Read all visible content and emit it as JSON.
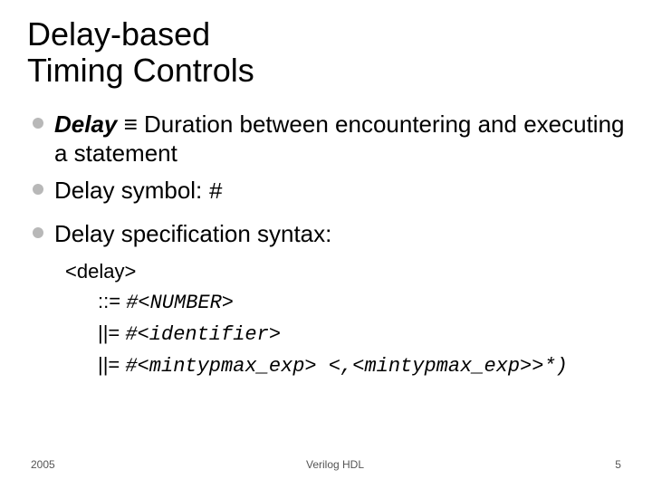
{
  "title_line1": "Delay-based",
  "title_line2": "Timing Controls",
  "bullets": [
    {
      "lead": "Delay",
      "sep": " ≡ ",
      "rest": "Duration between encountering and executing a statement"
    },
    {
      "text": "Delay symbol: ",
      "code": "#"
    },
    {
      "text": "Delay specification syntax:"
    }
  ],
  "syntax": {
    "lhs": "<delay>",
    "r1_op": "::= ",
    "r1_val": "#<NUMBER>",
    "r2_op": "||= ",
    "r2_val": "#<identifier>",
    "r3_op": "||= ",
    "r3_val": "#<mintypmax_exp> <,<mintypmax_exp>>*)"
  },
  "footer": {
    "left": "2005",
    "center": "Verilog HDL",
    "right": "5"
  }
}
